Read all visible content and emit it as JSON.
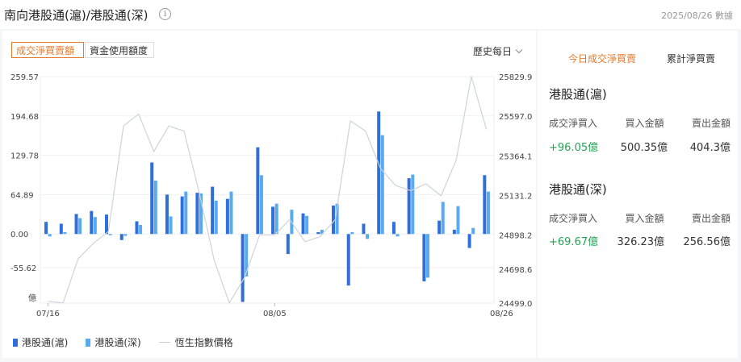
{
  "header": {
    "title": "南向港股通(滬)/港股通(深)",
    "info_icon": "info-icon",
    "date": "2025/08/26 數據"
  },
  "left_panel": {
    "tab_active": "成交淨買賣額",
    "tab_inactive": "資金使用額度",
    "period": "歷史每日"
  },
  "colors": {
    "sh": "#2e6fdc",
    "sz": "#5aaaf0",
    "index": "#cfd3d8",
    "accent": "#e87b2a",
    "positive": "#1fa653"
  },
  "chart_data": {
    "type": "bar",
    "left_unit": "億",
    "left_ticks": [
      "259.57",
      "194.68",
      "129.78",
      "64.89",
      "0.00",
      "-55.62"
    ],
    "right_ticks": [
      "25829.9",
      "25597.0",
      "25364.1",
      "25131.2",
      "24898.2",
      "24698.6",
      "24499.0"
    ],
    "x_labels": [
      "07/16",
      "08/05",
      "08/26"
    ],
    "x_label_index": [
      0,
      15,
      30
    ],
    "ylim_left": [
      -114,
      259.57
    ],
    "ylim_right": [
      24499.0,
      25829.9
    ],
    "series": [
      {
        "name": "港股通(滬)",
        "values": [
          20,
          17,
          33,
          38,
          32,
          -10,
          21,
          118,
          65,
          62,
          68,
          78,
          58,
          -112,
          143,
          45,
          -33,
          34,
          3,
          47,
          -85,
          17,
          202,
          20,
          92,
          -78,
          22,
          7,
          -23,
          97
        ]
      },
      {
        "name": "港股通(深)",
        "values": [
          -4,
          3,
          26,
          28,
          -2,
          -3,
          15,
          88,
          29,
          70,
          67,
          55,
          70,
          -70,
          97,
          50,
          40,
          30,
          7,
          50,
          3,
          -8,
          163,
          -4,
          98,
          -72,
          53,
          46,
          10,
          70
        ]
      },
      {
        "name": "恆生指數價格",
        "values": [
          24510,
          24500,
          24760,
          24850,
          24920,
          25540,
          25610,
          25390,
          25540,
          25510,
          25150,
          24750,
          24500,
          24650,
          24900,
          24900,
          24990,
          24860,
          24890,
          24990,
          25570,
          25510,
          25290,
          25190,
          25160,
          25200,
          25130,
          25340,
          25830,
          25520
        ]
      }
    ]
  },
  "right_panel": {
    "tab_active": "今日成交淨買賣",
    "tab_inactive": "累計淨買賣",
    "sections": [
      {
        "title": "港股通(滬)",
        "col1": "成交淨買入",
        "col2": "買入金額",
        "col3": "賣出金額",
        "net": "+96.05億",
        "buy": "500.35億",
        "sell": "404.3億"
      },
      {
        "title": "港股通(深)",
        "col1": "成交淨買入",
        "col2": "買入金額",
        "col3": "賣出金額",
        "net": "+69.67億",
        "buy": "326.23億",
        "sell": "256.56億"
      }
    ]
  }
}
